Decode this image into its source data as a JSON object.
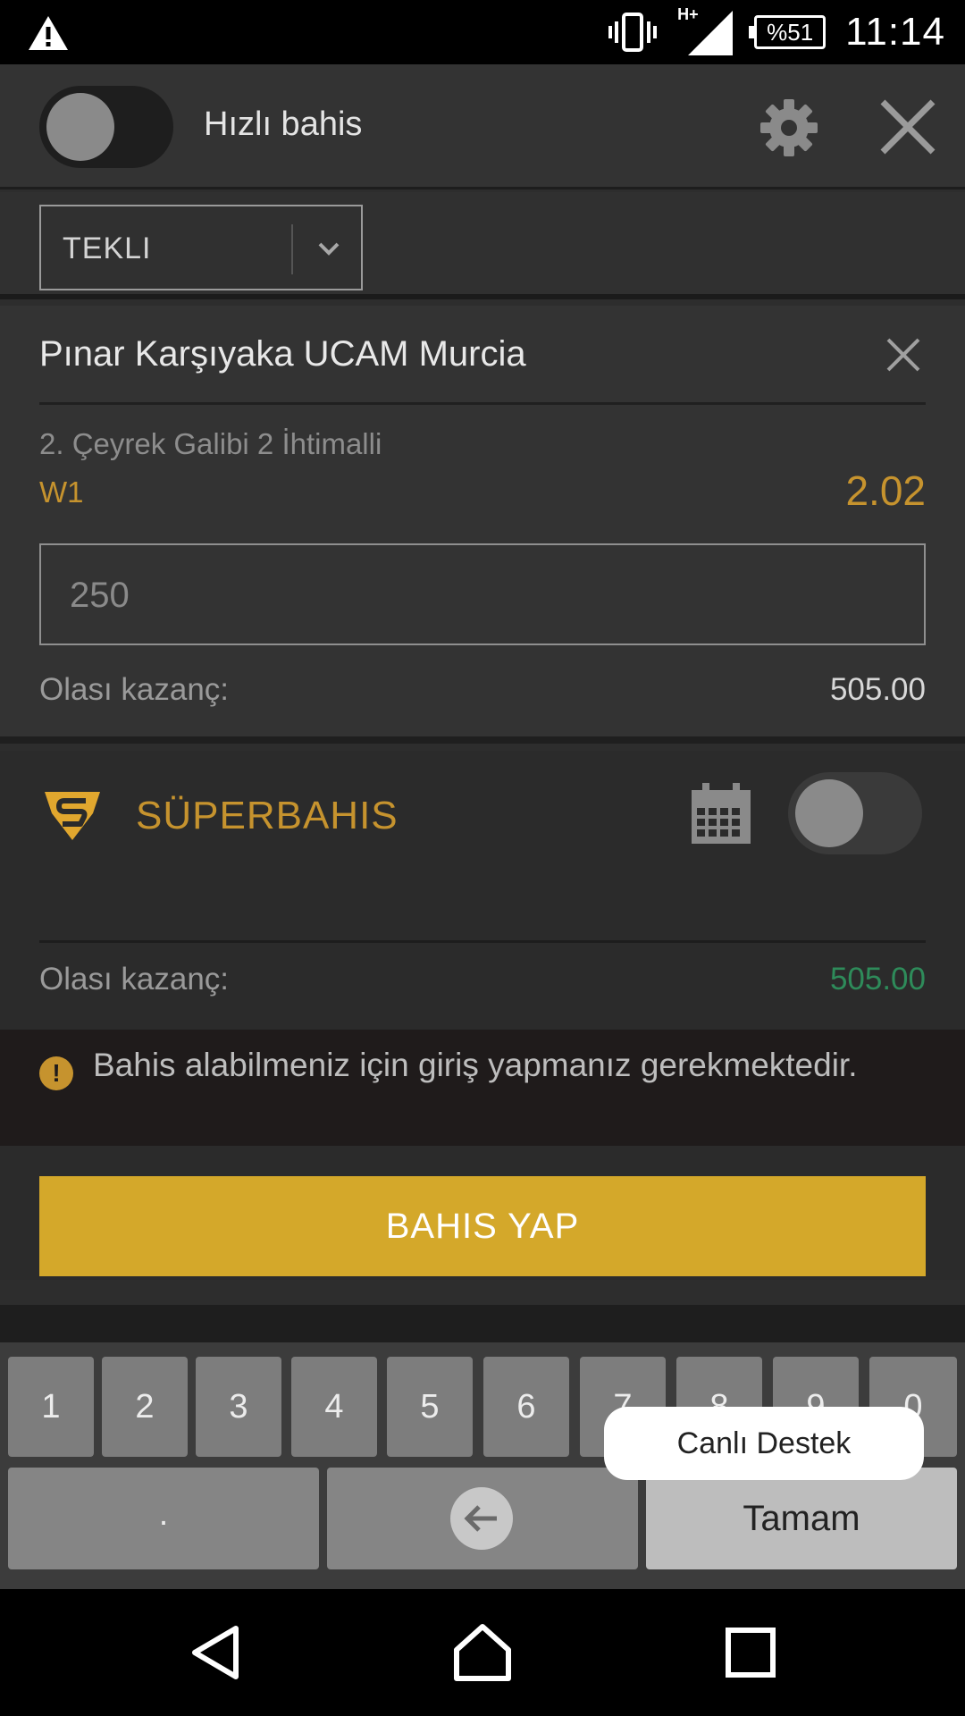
{
  "status_bar": {
    "time": "11:14",
    "battery": "%51",
    "network": "H+",
    "icons": [
      "warning-icon",
      "vibrate-icon",
      "signal-icon",
      "battery-icon"
    ]
  },
  "header": {
    "quick_bet_label": "Hızlı bahis",
    "quick_bet_enabled": false,
    "icons": [
      "settings-gear-icon",
      "close-icon"
    ]
  },
  "bet_type": {
    "selected": "TEKLI"
  },
  "bet_slip": {
    "match": "Pınar Karşıyaka UCAM Murcia",
    "market": "2. Çeyrek Galibi 2 İhtimalli",
    "outcome": "W1",
    "odds": "2.02",
    "stake": "250",
    "possible_win_label": "Olası kazanç:",
    "possible_win": "505.00"
  },
  "super_bet": {
    "title": "SÜPERBAHIS",
    "enabled": false,
    "possible_win_label": "Olası kazanç:",
    "possible_win": "505.00"
  },
  "notice": {
    "text": "Bahis alabilmeniz için giriş yapmanız gerekmektedir.",
    "icon": "!"
  },
  "action": {
    "place_bet": "BAHIS YAP"
  },
  "keyboard": {
    "digits": [
      "1",
      "2",
      "3",
      "4",
      "5",
      "6",
      "7",
      "8",
      "9",
      "0"
    ],
    "dot": ".",
    "done": "Tamam"
  },
  "live_support": {
    "label": "Canlı Destek"
  },
  "colors": {
    "accent": "#c6932e",
    "cta": "#d4a82a",
    "win_green": "#2e8b5a"
  }
}
